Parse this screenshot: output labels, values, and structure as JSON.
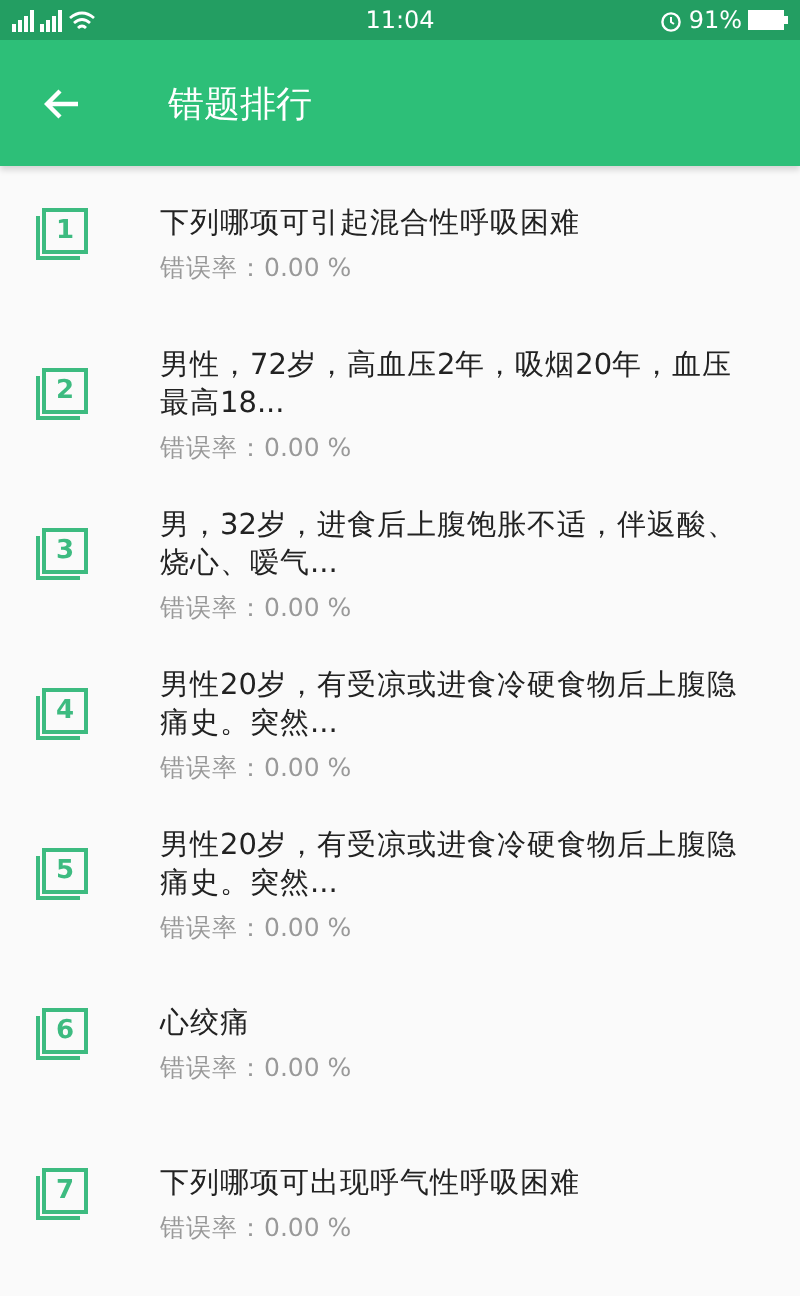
{
  "status_bar": {
    "time": "11:04",
    "battery": "91%"
  },
  "app_bar": {
    "title": "错题排行"
  },
  "items": [
    {
      "rank": "1",
      "title": "下列哪项可引起混合性呼吸困难",
      "rate": "错误率：0.00 %"
    },
    {
      "rank": "2",
      "title": "男性，72岁，高血压2年，吸烟20年，血压最高18...",
      "rate": "错误率：0.00 %"
    },
    {
      "rank": "3",
      "title": "男，32岁，进食后上腹饱胀不适，伴返酸、烧心、嗳气...",
      "rate": "错误率：0.00 %"
    },
    {
      "rank": "4",
      "title": "男性20岁，有受凉或进食冷硬食物后上腹隐痛史。突然...",
      "rate": "错误率：0.00 %"
    },
    {
      "rank": "5",
      "title": "男性20岁，有受凉或进食冷硬食物后上腹隐痛史。突然...",
      "rate": "错误率：0.00 %"
    },
    {
      "rank": "6",
      "title": "心绞痛",
      "rate": "错误率：0.00 %"
    },
    {
      "rank": "7",
      "title": "下列哪项可出现呼气性呼吸困难",
      "rate": "错误率：0.00 %"
    }
  ]
}
